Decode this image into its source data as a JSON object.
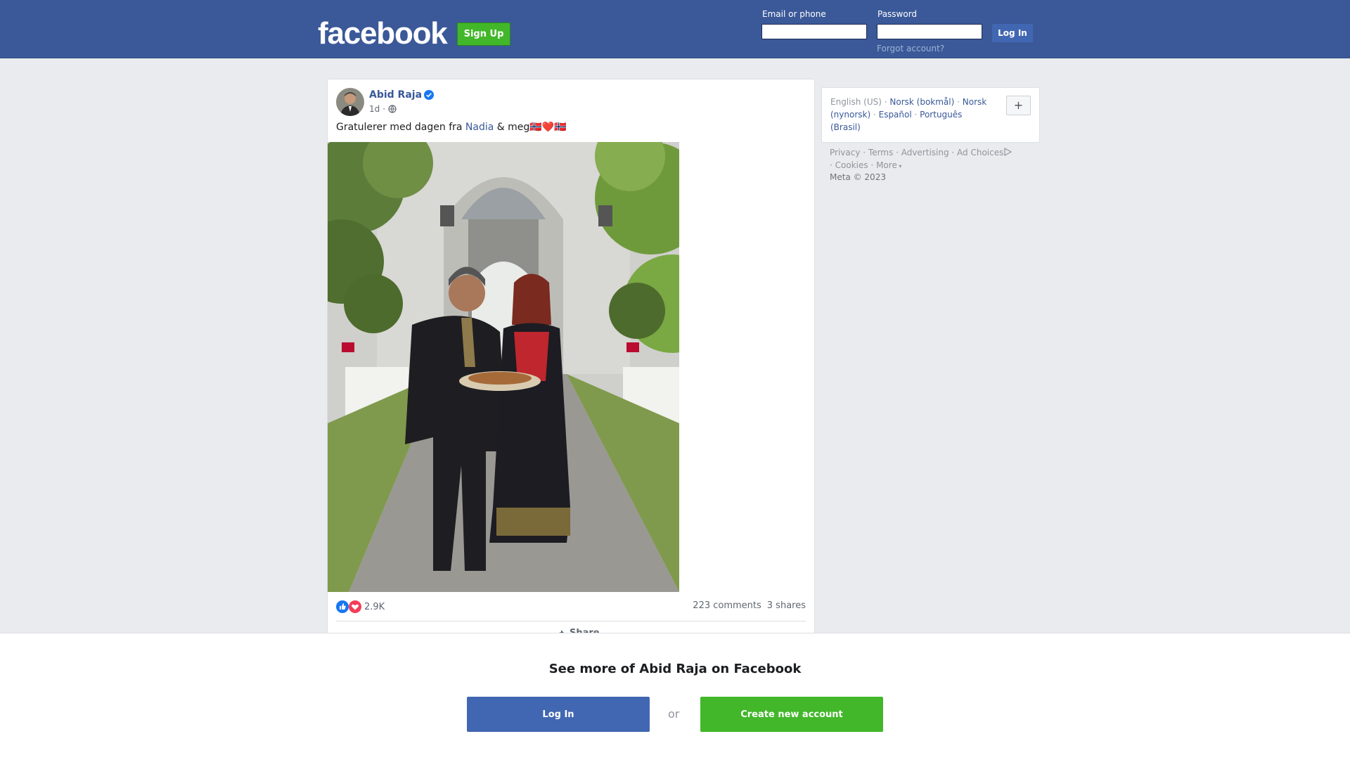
{
  "header": {
    "logo_text": "facebook",
    "signup_label": "Sign Up",
    "email_label": "Email or phone",
    "password_label": "Password",
    "login_label": "Log In",
    "forgot_label": "Forgot account?"
  },
  "post": {
    "author": "Abid Raja",
    "time": "1d",
    "text_before": "Gratulerer med dagen fra ",
    "mention": "Nadia",
    "text_after": " & meg🇳🇴❤️🇳🇴",
    "reaction_count": "2.9K",
    "comments": "223 comments",
    "shares": "3 shares",
    "share_label": "Share"
  },
  "languages": {
    "current": "English (US)",
    "items": [
      "Norsk (bokmål)",
      "Norsk (nynorsk)",
      "Español",
      "Português (Brasil)"
    ]
  },
  "footer": {
    "links": [
      "Privacy",
      "Terms",
      "Advertising",
      "Ad Choices",
      "Cookies",
      "More"
    ],
    "copyright": "Meta © 2023"
  },
  "overlay": {
    "title": "See more of Abid Raja on Facebook",
    "login_label": "Log In",
    "or_label": "or",
    "create_label": "Create new account"
  },
  "colors": {
    "brand_blue": "#3b5998",
    "button_blue": "#4267b2",
    "green": "#42b72a",
    "link": "#385898"
  }
}
